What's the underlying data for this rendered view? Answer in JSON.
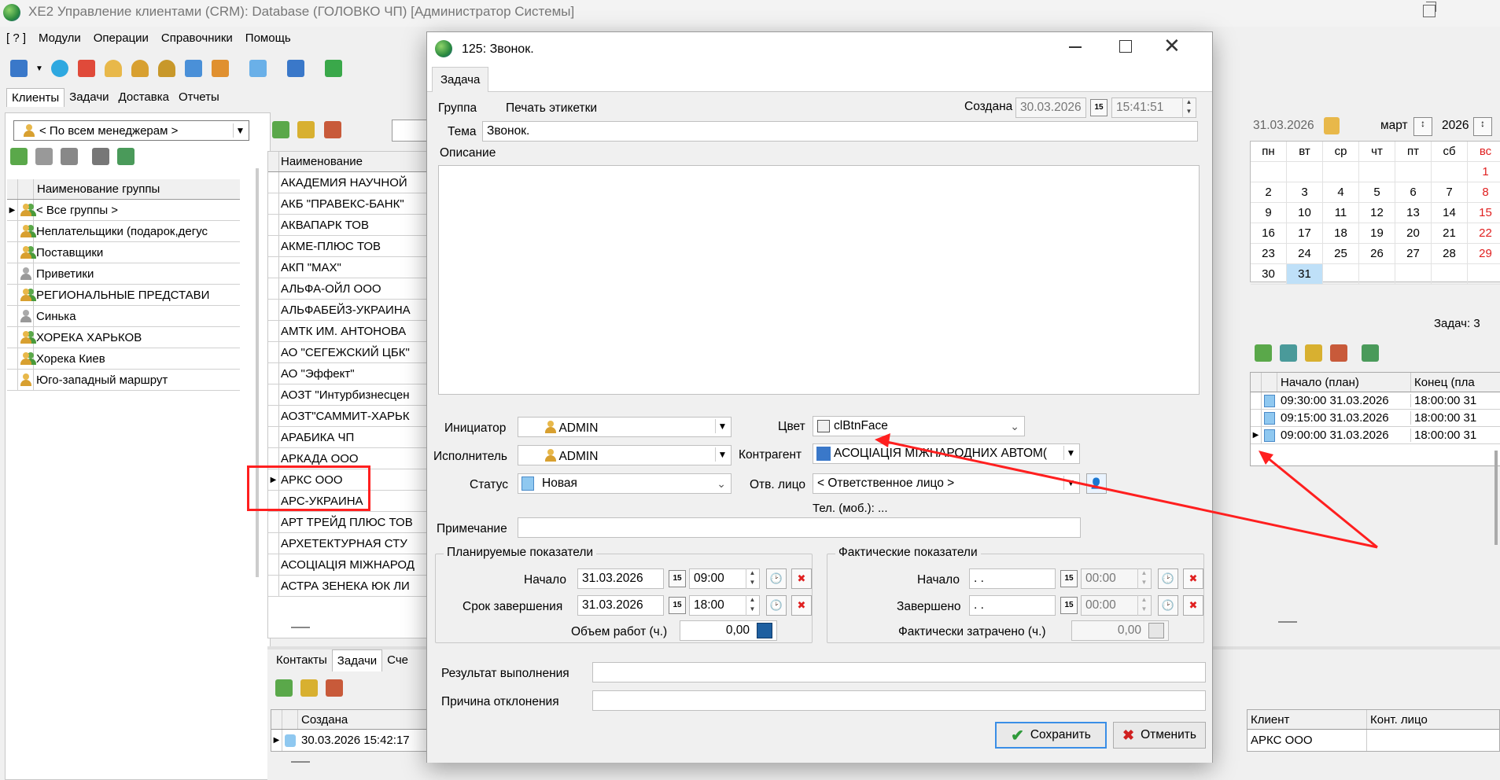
{
  "window": {
    "title": "XE2  Управление клиентами (CRM): Database (ГОЛОВКО ЧП) [Администратор Системы]"
  },
  "menu": [
    "[ ? ]",
    "Модули",
    "Операции",
    "Справочники",
    "Помощь"
  ],
  "left_tabs": [
    "Клиенты",
    "Задачи",
    "Доставка",
    "Отчеты"
  ],
  "manager_filter": "< По всем менеджерам >",
  "groups": {
    "header": "Наименование группы",
    "rows": [
      {
        "label": "< Все группы >",
        "icon": "group-icon",
        "current": true
      },
      {
        "label": "Неплательщики (подарок,дегус",
        "icon": "group-icon"
      },
      {
        "label": "Поставщики",
        "icon": "group-icon"
      },
      {
        "label": "Приветики",
        "icon": "user-gray-icon"
      },
      {
        "label": "РЕГИОНАЛЬНЫЕ ПРЕДСТАВИ",
        "icon": "group-icon"
      },
      {
        "label": "Синька",
        "icon": "user-gray-icon"
      },
      {
        "label": "ХОРЕКА ХАРЬКОВ",
        "icon": "group-icon"
      },
      {
        "label": "Хорека Киев",
        "icon": "group-icon"
      },
      {
        "label": "Юго-западный маршрут",
        "icon": "user-icon"
      }
    ]
  },
  "clients": {
    "header": "Наименование",
    "rows": [
      "АКАДЕМИЯ НАУЧНОЙ",
      "АКБ \"ПРАВЕКС-БАНК\"",
      "АКВАПАРК ТОВ",
      "АКМЕ-ПЛЮС ТОВ",
      "АКП \"MAX\"",
      "АЛЬФА-ОЙЛ ООО",
      "АЛЬФАБЕЙЗ-УКРАИНА",
      "АМТК ИМ. АНТОНОВА",
      "АО \"СЕГЕЖСКИЙ ЦБК\"",
      "АО \"Эффект\"",
      "АОЗТ \"Интурбизнесцен",
      "АОЗТ\"САММИТ-ХАРЬК",
      "АРАБИКА ЧП",
      "АРКАДА ООО",
      "АРКС ООО",
      "АРС-УКРАИНА",
      "АРТ ТРЕЙД ПЛЮС ТОВ",
      "АРХЕТЕКТУРНАЯ СТУ",
      "АСОЦІАЦІЯ МІЖНАРОД",
      "АСТРА ЗЕНЕКА ЮК ЛИ"
    ],
    "current_index": 14
  },
  "bottom": {
    "tabs": [
      "Контакты",
      "Задачи",
      "Сче"
    ],
    "col_created": "Создана",
    "row_created": "30.03.2026 15:42:17",
    "col_client": "Клиент",
    "col_contact": "Конт. лицо",
    "row_client": "АРКС ООО"
  },
  "right": {
    "date": "31.03.2026",
    "month": "март",
    "year": "2026",
    "weekdays": [
      "пн",
      "вт",
      "ср",
      "чт",
      "пт",
      "сб",
      "вс"
    ],
    "weeks": [
      [
        "",
        "",
        "",
        "",
        "",
        "",
        "1"
      ],
      [
        "2",
        "3",
        "4",
        "5",
        "6",
        "7",
        "8"
      ],
      [
        "9",
        "10",
        "11",
        "12",
        "13",
        "14",
        "15"
      ],
      [
        "16",
        "17",
        "18",
        "19",
        "20",
        "21",
        "22"
      ],
      [
        "23",
        "24",
        "25",
        "26",
        "27",
        "28",
        "29"
      ],
      [
        "30",
        "31",
        "",
        "",
        "",
        "",
        ""
      ]
    ],
    "selected_day": "31",
    "tasks_label": "Задач: 3",
    "col_start": "Начало (план)",
    "col_end": "Конец (пла",
    "task_rows": [
      {
        "start": "09:30:00 31.03.2026",
        "end": "18:00:00 31"
      },
      {
        "start": "09:15:00 31.03.2026",
        "end": "18:00:00 31"
      },
      {
        "start": "09:00:00 31.03.2026",
        "end": "18:00:00 31"
      }
    ]
  },
  "dialog": {
    "title": "125: Звонок.",
    "tab": "Задача",
    "group_label": "Группа",
    "group_value": "Печать этикетки",
    "created_label": "Создана",
    "created_date": "30.03.2026",
    "created_time": "15:41:51",
    "topic_label": "Тема",
    "topic_value": "Звонок.",
    "description_label": "Описание",
    "initiator_label": "Инициатор",
    "initiator_value": "ADMIN",
    "executor_label": "Исполнитель",
    "executor_value": "ADMIN",
    "status_label": "Статус",
    "status_value": "Новая",
    "color_label": "Цвет",
    "color_value": "clBtnFace",
    "contragent_label": "Контрагент",
    "contragent_value": "АСОЦІАЦІЯ МІЖНАРОДНИХ АВТОМ(",
    "contact_label": "Отв. лицо",
    "contact_value": "< Ответственное лицо >",
    "phone_label": "Тел. (моб.): ...",
    "note_label": "Примечание",
    "planned": {
      "title": "Планируемые показатели",
      "start_label": "Начало",
      "start_date": "31.03.2026",
      "start_time": "09:00",
      "end_label": "Срок завершения",
      "end_date": "31.03.2026",
      "end_time": "18:00",
      "volume_label": "Объем работ (ч.)",
      "volume_value": "0,00"
    },
    "actual": {
      "title": "Фактические показатели",
      "start_label": "Начало",
      "start_date": "  .  .",
      "start_time": "00:00",
      "end_label": "Завершено",
      "end_date": "  .  .",
      "end_time": "00:00",
      "spent_label": "Фактически затрачено (ч.)",
      "spent_value": "0,00"
    },
    "result_label": "Результат выполнения",
    "reason_label": "Причина отклонения",
    "save_label": "Сохранить",
    "cancel_label": "Отменить"
  },
  "colors": {
    "annotation_red": "#ff1f1f",
    "selection": "#bfe0f8",
    "sunday": "#e02020"
  }
}
